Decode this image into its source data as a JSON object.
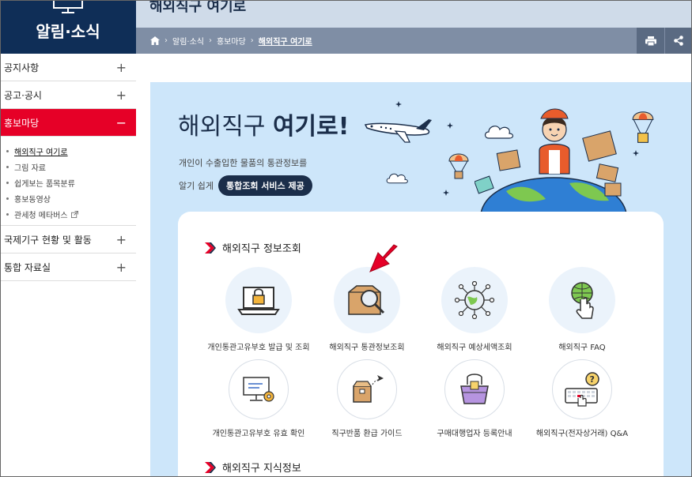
{
  "sidebar": {
    "title": "알림·소식",
    "items": [
      {
        "label": "공지사항",
        "toggle": "+"
      },
      {
        "label": "공고·공시",
        "toggle": "+"
      },
      {
        "label": "홍보마당",
        "toggle": "−"
      },
      {
        "label": "국제기구 현황 및 활동",
        "toggle": "+"
      },
      {
        "label": "통합 자료실",
        "toggle": "+"
      }
    ],
    "subitems": [
      {
        "label": "해외직구 여기로"
      },
      {
        "label": "그림 자료"
      },
      {
        "label": "쉽게보는 품목분류"
      },
      {
        "label": "홍보동영상"
      },
      {
        "label": "관세청 메타버스"
      }
    ]
  },
  "header": {
    "title": "해외직구 여기로",
    "breadcrumb": [
      "알림·소식",
      "홍보마당",
      "해외직구 여기로"
    ]
  },
  "hero": {
    "title_normal": "해외직구 ",
    "title_bold": "여기로!",
    "sub1": "개인이 수출입한 물품의 통관정보를",
    "sub2": "알기 쉽게",
    "pill": "통합조회 서비스 제공"
  },
  "section1": {
    "heading": "해외직구 정보조회",
    "services": [
      {
        "label": "개인통관고유부호 발급 및 조회",
        "icon": "laptop-lock-icon"
      },
      {
        "label": "해외직구 통관정보조회",
        "icon": "box-magnifier-icon"
      },
      {
        "label": "해외직구 예상세액조회",
        "icon": "globe-network-icon"
      },
      {
        "label": "해외직구 FAQ",
        "icon": "globe-hand-icon"
      },
      {
        "label": "개인통관고유부호 유효 확인",
        "icon": "monitor-gear-icon"
      },
      {
        "label": "직구반품 환급 가이드",
        "icon": "box-plane-icon"
      },
      {
        "label": "구매대행업자 등록안내",
        "icon": "gift-basket-icon"
      },
      {
        "label": "해외직구(전자상거래) Q&A",
        "icon": "keyboard-question-icon"
      }
    ]
  },
  "section2": {
    "heading": "해외직구 지식정보"
  },
  "colors": {
    "navy": "#0f2e57",
    "accent_red": "#e60027",
    "panel_blue": "#cde6fa"
  }
}
